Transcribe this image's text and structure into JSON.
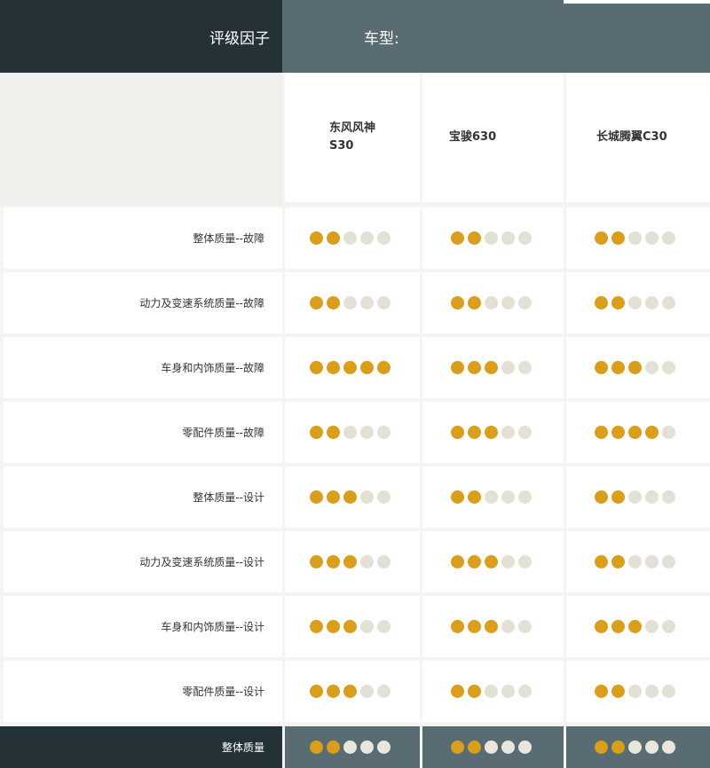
{
  "header": {
    "factor_label": "评级因子",
    "model_label": "车型:"
  },
  "models": [
    {
      "name_line1": "东风风神",
      "name_line2": "S30"
    },
    {
      "name_line1": "宝骏630",
      "name_line2": ""
    },
    {
      "name_line1": "长城腾翼C30",
      "name_line2": ""
    }
  ],
  "max_rating": 5,
  "rows": [
    {
      "label": "整体质量--故障",
      "ratings": [
        2,
        2,
        2
      ]
    },
    {
      "label": "动力及变速系统质量--故障",
      "ratings": [
        2,
        2,
        2
      ]
    },
    {
      "label": "车身和内饰质量--故障",
      "ratings": [
        5,
        3,
        3
      ]
    },
    {
      "label": "零配件质量--故障",
      "ratings": [
        2,
        3,
        4
      ]
    },
    {
      "label": "整体质量--设计",
      "ratings": [
        3,
        2,
        2
      ]
    },
    {
      "label": "动力及变速系统质量--设计",
      "ratings": [
        3,
        3,
        2
      ]
    },
    {
      "label": "车身和内饰质量--设计",
      "ratings": [
        3,
        3,
        3
      ]
    },
    {
      "label": "零配件质量--设计",
      "ratings": [
        3,
        2,
        2
      ]
    }
  ],
  "footer": {
    "label": "整体质量",
    "ratings": [
      2,
      2,
      2
    ]
  },
  "colors": {
    "dark_header": "#243137",
    "slate_header": "#596b73",
    "dot_filled": "#d99e1c",
    "dot_empty": "#e3e0d5"
  }
}
